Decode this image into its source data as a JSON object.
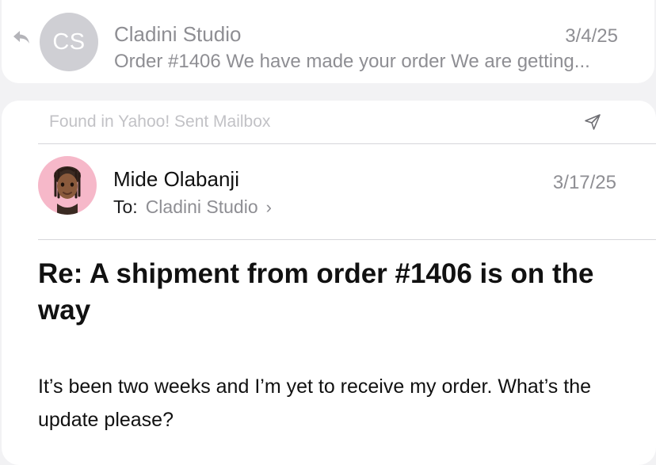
{
  "previous_message": {
    "avatar_initials": "CS",
    "sender": "Cladini Studio",
    "date": "3/4/25",
    "snippet": "Order #1406 We have made your order We are getting..."
  },
  "current_message": {
    "found_in": "Found in Yahoo! Sent Mailbox",
    "sender": "Mide Olabanji",
    "date": "3/17/25",
    "to_label": "To:",
    "to_recipient": "Cladini Studio",
    "subject": "Re: A shipment from order #1406 is on the way",
    "body": "It’s been two weeks and I’m yet to receive my order. What’s the update please?"
  },
  "icons": {
    "reply": "reply-arrow-icon",
    "sent": "paper-plane-icon",
    "chevron": "chevron-right-icon",
    "avatar": "memoji-avatar"
  },
  "colors": {
    "background": "#f2f2f4",
    "card": "#ffffff",
    "secondary_text": "#8e8e93",
    "primary_text": "#111111",
    "avatar_initials_bg": "#cfcfd4",
    "avatar_memoji_bg": "#f6b8c9"
  }
}
